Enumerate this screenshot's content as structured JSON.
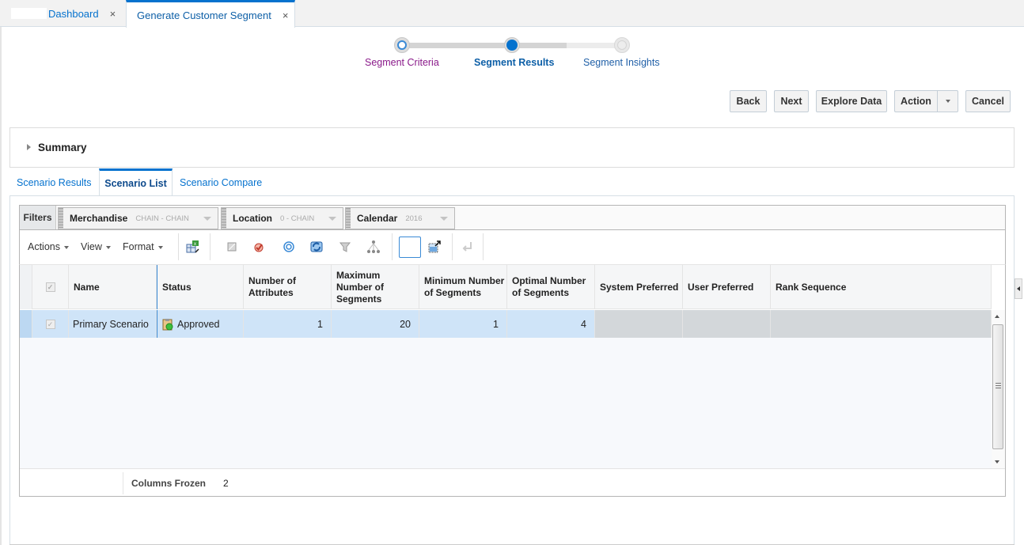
{
  "tabs": [
    {
      "label": "Dashboard",
      "close": "×"
    },
    {
      "label": "Generate Customer Segment",
      "close": "×"
    }
  ],
  "train": {
    "steps": [
      {
        "label": "Segment Criteria",
        "state": "visited",
        "color": "#8a1a8a"
      },
      {
        "label": "Segment Results",
        "state": "current",
        "color": "#0d5fa7"
      },
      {
        "label": "Segment Insights",
        "state": "unvisited",
        "color": "#1f5fa7"
      }
    ]
  },
  "buttons": {
    "back": "Back",
    "next": "Next",
    "explore": "Explore Data",
    "action": "Action",
    "cancel": "Cancel"
  },
  "summary": {
    "label": "Summary"
  },
  "subtabs": [
    {
      "label": "Scenario Results"
    },
    {
      "label": "Scenario List"
    },
    {
      "label": "Scenario Compare"
    }
  ],
  "filters": {
    "label": "Filters",
    "chips": [
      {
        "name": "Merchandise",
        "value": "CHAIN - CHAIN"
      },
      {
        "name": "Location",
        "value": "0 - CHAIN"
      },
      {
        "name": "Calendar",
        "value": "2016"
      }
    ]
  },
  "toolbar": {
    "menus": [
      "Actions",
      "View",
      "Format"
    ],
    "icons": [
      "export-excel-icon",
      "select-all-icon",
      "approve-icon",
      "target-icon",
      "refresh-icon",
      "filter-icon",
      "hierarchy-icon",
      "freeze-column-icon",
      "detach-icon",
      "wrap-icon"
    ]
  },
  "table": {
    "columns": [
      "Name",
      "Status",
      "Number of Attributes",
      "Maximum Number of Segments",
      "Minimum Number of Segments",
      "Optimal Number of Segments",
      "System Preferred",
      "User Preferred",
      "Rank Sequence"
    ],
    "rows": [
      {
        "name": "Primary Scenario",
        "status": "Approved",
        "num_attributes": "1",
        "max_segments": "20",
        "min_segments": "1",
        "optimal_segments": "4",
        "system_preferred": "",
        "user_preferred": "",
        "rank_sequence": ""
      }
    ]
  },
  "footer": {
    "label": "Columns Frozen",
    "value": "2"
  }
}
